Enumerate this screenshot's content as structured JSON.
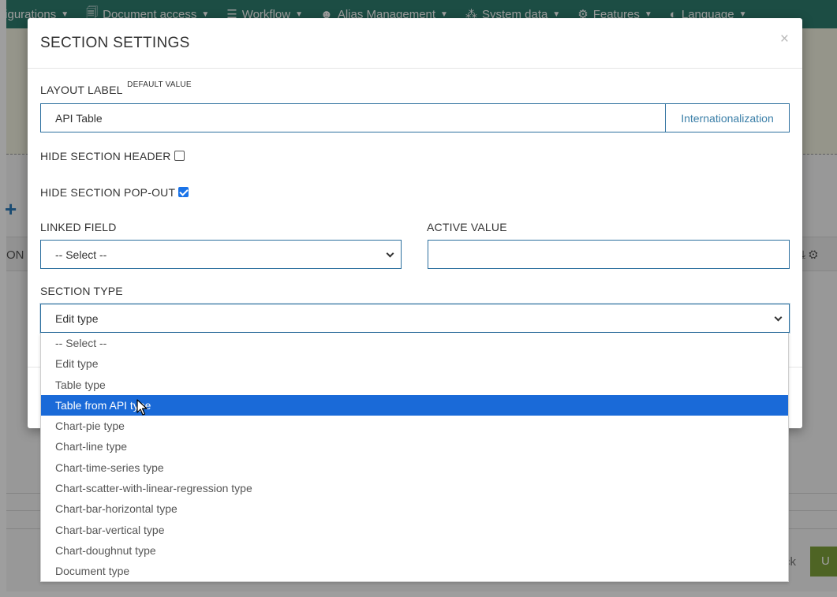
{
  "navbar": {
    "items": [
      {
        "label": "figurations",
        "icon": "none"
      },
      {
        "label": "Document access",
        "icon": "document-icon"
      },
      {
        "label": "Workflow",
        "icon": "workflow-icon"
      },
      {
        "label": "Alias Management",
        "icon": "user-icon"
      },
      {
        "label": "System data",
        "icon": "network-icon"
      },
      {
        "label": "Features",
        "icon": "gears-icon"
      },
      {
        "label": "Language",
        "icon": "language-icon"
      }
    ],
    "color": "#2e7d6e"
  },
  "background": {
    "plus": "+",
    "row_fragment": "ON",
    "back_button": "ck",
    "save_button": "U"
  },
  "modal": {
    "title": "SECTION SETTINGS",
    "close": "×",
    "layout_label": {
      "label": "LAYOUT LABEL",
      "sup": "DEFAULT VALUE",
      "value": "API Table",
      "addon": "Internationalization"
    },
    "hide_section_header": {
      "label": "HIDE SECTION HEADER",
      "checked": false
    },
    "hide_section_popout": {
      "label": "HIDE SECTION POP-OUT",
      "checked": true
    },
    "linked_field": {
      "label": "LINKED FIELD",
      "value": "-- Select --"
    },
    "active_value": {
      "label": "ACTIVE VALUE",
      "value": ""
    },
    "section_type": {
      "label": "SECTION TYPE",
      "value": "Edit type",
      "highlighted_index": 3,
      "options": [
        "-- Select --",
        "Edit type",
        "Table type",
        "Table from API type",
        "Chart-pie type",
        "Chart-line type",
        "Chart-time-series type",
        "Chart-scatter-with-linear-regression type",
        "Chart-bar-horizontal type",
        "Chart-bar-vertical type",
        "Chart-doughnut type",
        "Document type"
      ]
    }
  },
  "colors": {
    "accent_border": "#2c6f9e",
    "highlight": "#1a6ad8",
    "checkbox": "#1a73e8"
  }
}
